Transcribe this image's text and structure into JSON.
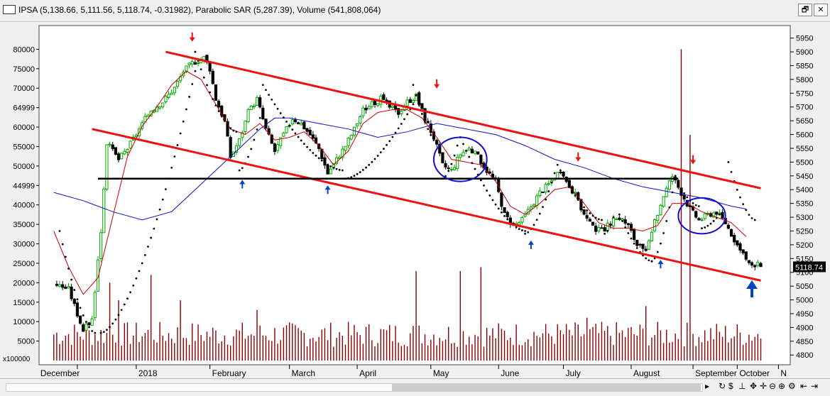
{
  "window": {
    "title": "IPSA (5,138.66, 5,111.56, 5,118.74, -0.31982), Parabolic SAR (5,287.39), Volume (541,808,064)",
    "restore_label": "🗗",
    "close_label": "✕"
  },
  "colors": {
    "background": "#ffffff",
    "up_candle": "#00aa00",
    "down_candle": "#000000",
    "volume": "#8b0000",
    "sar": "#000000",
    "ma_fast": "#cc0000",
    "ma_slow": "#1010cc",
    "channel": "#ee1111",
    "support": "#000000",
    "arrow_down": "#ee1111",
    "arrow_up": "#0044cc"
  },
  "chart_data": {
    "type": "candlestick",
    "title": "IPSA",
    "price_axis": {
      "side": "right",
      "ticks": [
        "5950",
        "5900",
        "5850",
        "5800",
        "5750",
        "5700",
        "5650",
        "5600",
        "5550",
        "5500",
        "5450",
        "5400",
        "5350",
        "5300",
        "5250",
        "5200",
        "5150",
        "5100",
        "5050",
        "5000",
        "4950",
        "4900",
        "4850",
        "4800"
      ],
      "range": [
        4780,
        5980
      ],
      "last_price": "5118.74"
    },
    "volume_axis": {
      "side": "left",
      "ticks": [
        "80000",
        "75000",
        "70000",
        "64999",
        "60000",
        "55000",
        "50000",
        "44999",
        "40000",
        "35000",
        "30000",
        "25000",
        "20000",
        "15000",
        "10000",
        "5000"
      ],
      "range": [
        0,
        85000
      ],
      "multiplier": "x100000"
    },
    "months": [
      "December",
      "2018",
      "February",
      "March",
      "April",
      "May",
      "June",
      "July",
      "August",
      "September",
      "October",
      "N"
    ],
    "close_path": [
      [
        0,
        5060
      ],
      [
        5,
        5040
      ],
      [
        10,
        4890
      ],
      [
        13,
        4930
      ],
      [
        16,
        5250
      ],
      [
        18,
        5570
      ],
      [
        22,
        5510
      ],
      [
        25,
        5550
      ],
      [
        29,
        5620
      ],
      [
        33,
        5690
      ],
      [
        37,
        5720
      ],
      [
        41,
        5770
      ],
      [
        44,
        5830
      ],
      [
        47,
        5860
      ],
      [
        51,
        5880
      ],
      [
        53,
        5840
      ],
      [
        55,
        5730
      ],
      [
        58,
        5650
      ],
      [
        60,
        5520
      ],
      [
        63,
        5580
      ],
      [
        66,
        5680
      ],
      [
        69,
        5730
      ],
      [
        72,
        5620
      ],
      [
        75,
        5540
      ],
      [
        78,
        5600
      ],
      [
        81,
        5660
      ],
      [
        84,
        5640
      ],
      [
        87,
        5600
      ],
      [
        90,
        5550
      ],
      [
        93,
        5460
      ],
      [
        96,
        5510
      ],
      [
        99,
        5560
      ],
      [
        102,
        5620
      ],
      [
        105,
        5690
      ],
      [
        108,
        5710
      ],
      [
        111,
        5730
      ],
      [
        114,
        5700
      ],
      [
        117,
        5680
      ],
      [
        120,
        5720
      ],
      [
        123,
        5740
      ],
      [
        126,
        5660
      ],
      [
        129,
        5590
      ],
      [
        132,
        5490
      ],
      [
        135,
        5470
      ],
      [
        138,
        5530
      ],
      [
        141,
        5550
      ],
      [
        144,
        5520
      ],
      [
        147,
        5470
      ],
      [
        150,
        5430
      ],
      [
        153,
        5310
      ],
      [
        156,
        5270
      ],
      [
        159,
        5290
      ],
      [
        162,
        5340
      ],
      [
        165,
        5390
      ],
      [
        168,
        5420
      ],
      [
        171,
        5460
      ],
      [
        174,
        5430
      ],
      [
        177,
        5380
      ],
      [
        180,
        5310
      ],
      [
        183,
        5260
      ],
      [
        186,
        5250
      ],
      [
        189,
        5280
      ],
      [
        192,
        5300
      ],
      [
        195,
        5270
      ],
      [
        198,
        5200
      ],
      [
        201,
        5170
      ],
      [
        204,
        5280
      ],
      [
        207,
        5380
      ],
      [
        210,
        5450
      ],
      [
        213,
        5390
      ],
      [
        216,
        5330
      ],
      [
        219,
        5290
      ],
      [
        222,
        5310
      ],
      [
        225,
        5320
      ],
      [
        228,
        5280
      ],
      [
        231,
        5220
      ],
      [
        234,
        5160
      ],
      [
        237,
        5120
      ],
      [
        240,
        5130
      ]
    ],
    "ma_fast_path": [
      [
        0,
        5250
      ],
      [
        5,
        5120
      ],
      [
        10,
        5020
      ],
      [
        15,
        5080
      ],
      [
        20,
        5300
      ],
      [
        25,
        5520
      ],
      [
        30,
        5630
      ],
      [
        35,
        5700
      ],
      [
        40,
        5780
      ],
      [
        45,
        5830
      ],
      [
        50,
        5800
      ],
      [
        55,
        5710
      ],
      [
        60,
        5620
      ],
      [
        65,
        5600
      ],
      [
        70,
        5640
      ],
      [
        75,
        5580
      ],
      [
        80,
        5590
      ],
      [
        85,
        5610
      ],
      [
        90,
        5560
      ],
      [
        95,
        5490
      ],
      [
        100,
        5540
      ],
      [
        105,
        5640
      ],
      [
        110,
        5680
      ],
      [
        115,
        5690
      ],
      [
        120,
        5690
      ],
      [
        125,
        5660
      ],
      [
        130,
        5590
      ],
      [
        135,
        5510
      ],
      [
        140,
        5500
      ],
      [
        145,
        5490
      ],
      [
        150,
        5430
      ],
      [
        155,
        5340
      ],
      [
        160,
        5310
      ],
      [
        165,
        5350
      ],
      [
        170,
        5400
      ],
      [
        175,
        5410
      ],
      [
        180,
        5350
      ],
      [
        185,
        5280
      ],
      [
        190,
        5260
      ],
      [
        195,
        5260
      ],
      [
        200,
        5250
      ],
      [
        205,
        5270
      ],
      [
        210,
        5350
      ],
      [
        215,
        5350
      ],
      [
        220,
        5320
      ],
      [
        225,
        5300
      ],
      [
        230,
        5280
      ],
      [
        235,
        5230
      ]
    ],
    "ma_slow_path": [
      [
        0,
        5390
      ],
      [
        10,
        5360
      ],
      [
        20,
        5320
      ],
      [
        30,
        5290
      ],
      [
        40,
        5320
      ],
      [
        50,
        5420
      ],
      [
        60,
        5520
      ],
      [
        70,
        5620
      ],
      [
        75,
        5660
      ],
      [
        80,
        5660
      ],
      [
        90,
        5640
      ],
      [
        100,
        5620
      ],
      [
        110,
        5590
      ],
      [
        120,
        5610
      ],
      [
        130,
        5640
      ],
      [
        140,
        5620
      ],
      [
        150,
        5600
      ],
      [
        160,
        5560
      ],
      [
        170,
        5510
      ],
      [
        180,
        5480
      ],
      [
        190,
        5440
      ],
      [
        200,
        5410
      ],
      [
        210,
        5390
      ],
      [
        220,
        5370
      ],
      [
        230,
        5340
      ],
      [
        235,
        5330
      ]
    ],
    "sar_segments": [
      {
        "t0": 2,
        "t1": 14,
        "v0": 5250,
        "v1": 4880,
        "side": "above"
      },
      {
        "t0": 16,
        "t1": 48,
        "v0": 4880,
        "v1": 5830,
        "side": "below"
      },
      {
        "t0": 48,
        "t1": 62,
        "v0": 5900,
        "v1": 5610,
        "side": "above"
      },
      {
        "t0": 63,
        "t1": 70,
        "v0": 5470,
        "v1": 5660,
        "side": "below"
      },
      {
        "t0": 71,
        "t1": 98,
        "v0": 5780,
        "v1": 5470,
        "side": "above"
      },
      {
        "t0": 99,
        "t1": 122,
        "v0": 5440,
        "v1": 5710,
        "side": "below"
      },
      {
        "t0": 122,
        "t1": 131,
        "v0": 5780,
        "v1": 5560,
        "side": "above"
      },
      {
        "t0": 132,
        "t1": 137,
        "v0": 5440,
        "v1": 5560,
        "side": "below"
      },
      {
        "t0": 138,
        "t1": 160,
        "v0": 5590,
        "v1": 5250,
        "side": "above"
      },
      {
        "t0": 160,
        "t1": 170,
        "v0": 5240,
        "v1": 5460,
        "side": "below"
      },
      {
        "t0": 171,
        "t1": 186,
        "v0": 5490,
        "v1": 5290,
        "side": "above"
      },
      {
        "t0": 187,
        "t1": 190,
        "v0": 5240,
        "v1": 5300,
        "side": "below"
      },
      {
        "t0": 192,
        "t1": 203,
        "v0": 5310,
        "v1": 5140,
        "side": "above"
      },
      {
        "t0": 203,
        "t1": 211,
        "v0": 5140,
        "v1": 5450,
        "side": "below"
      },
      {
        "t0": 212,
        "t1": 219,
        "v0": 5420,
        "v1": 5340,
        "side": "above"
      },
      {
        "t0": 220,
        "t1": 226,
        "v0": 5260,
        "v1": 5310,
        "side": "below"
      },
      {
        "t0": 229,
        "t1": 238,
        "v0": 5500,
        "v1": 5290,
        "side": "above"
      }
    ],
    "channel_upper": [
      [
        38,
        5900
      ],
      [
        240,
        5405
      ]
    ],
    "channel_lower": [
      [
        13,
        5620
      ],
      [
        240,
        5070
      ]
    ],
    "support_line": [
      [
        15,
        5440
      ],
      [
        212,
        5440
      ]
    ],
    "ellipses": [
      {
        "t": 138,
        "v": 5510,
        "rt": 9,
        "rv": 80
      },
      {
        "t": 220,
        "v": 5305,
        "rt": 8,
        "rv": 65
      }
    ],
    "arrows_down": [
      [
        47,
        5955
      ],
      [
        130,
        5785
      ],
      [
        178,
        5520
      ],
      [
        217,
        5510
      ]
    ],
    "arrows_up": [
      [
        64,
        5420
      ],
      [
        93,
        5400
      ],
      [
        162,
        5200
      ],
      [
        206,
        5130
      ],
      [
        237,
        5040
      ]
    ],
    "volume_spikes": [
      [
        33,
        22000
      ],
      [
        43,
        15500
      ],
      [
        69,
        13000
      ],
      [
        123,
        23000
      ],
      [
        138,
        23000
      ],
      [
        145,
        24000
      ],
      [
        181,
        11000
      ],
      [
        213,
        80000
      ],
      [
        216,
        58000
      ],
      [
        201,
        14000
      ],
      [
        19,
        20000
      ],
      [
        22,
        15500
      ]
    ],
    "last_price_label": "5118.74"
  }
}
